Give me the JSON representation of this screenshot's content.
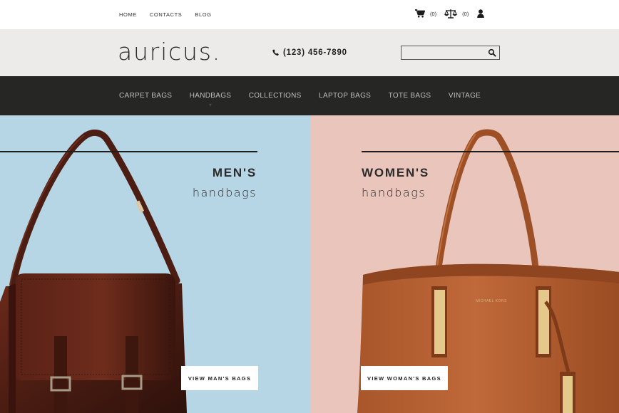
{
  "topbar": {
    "links": [
      "HOME",
      "CONTACTS",
      "BLOG"
    ],
    "cart_count": "(0)",
    "compare_count": "(0)"
  },
  "header": {
    "logo": "auricus.",
    "phone": "(123) 456-7890",
    "search": {
      "value": "",
      "placeholder": ""
    }
  },
  "nav": {
    "items": [
      "CARPET BAGS",
      "HANDBAGS",
      "COLLECTIONS",
      "LAPTOP BAGS",
      "TOTE BAGS",
      "VINTAGE"
    ]
  },
  "hero": {
    "men": {
      "title": "MEN'S",
      "subtitle": "handbags",
      "button": "VIEW MAN'S BAGS"
    },
    "women": {
      "title": "WOMEN'S",
      "subtitle": "handbags",
      "button": "VIEW WOMAN'S BAGS"
    }
  },
  "colors": {
    "men_bg": "#b7d6e5",
    "women_bg": "#e9c5bc",
    "nav_bg": "#262625",
    "header_bg": "#edebe9"
  },
  "icons": [
    "cart-icon",
    "compare-scale-icon",
    "user-icon",
    "phone-icon",
    "search-icon",
    "chevron-down-icon"
  ]
}
